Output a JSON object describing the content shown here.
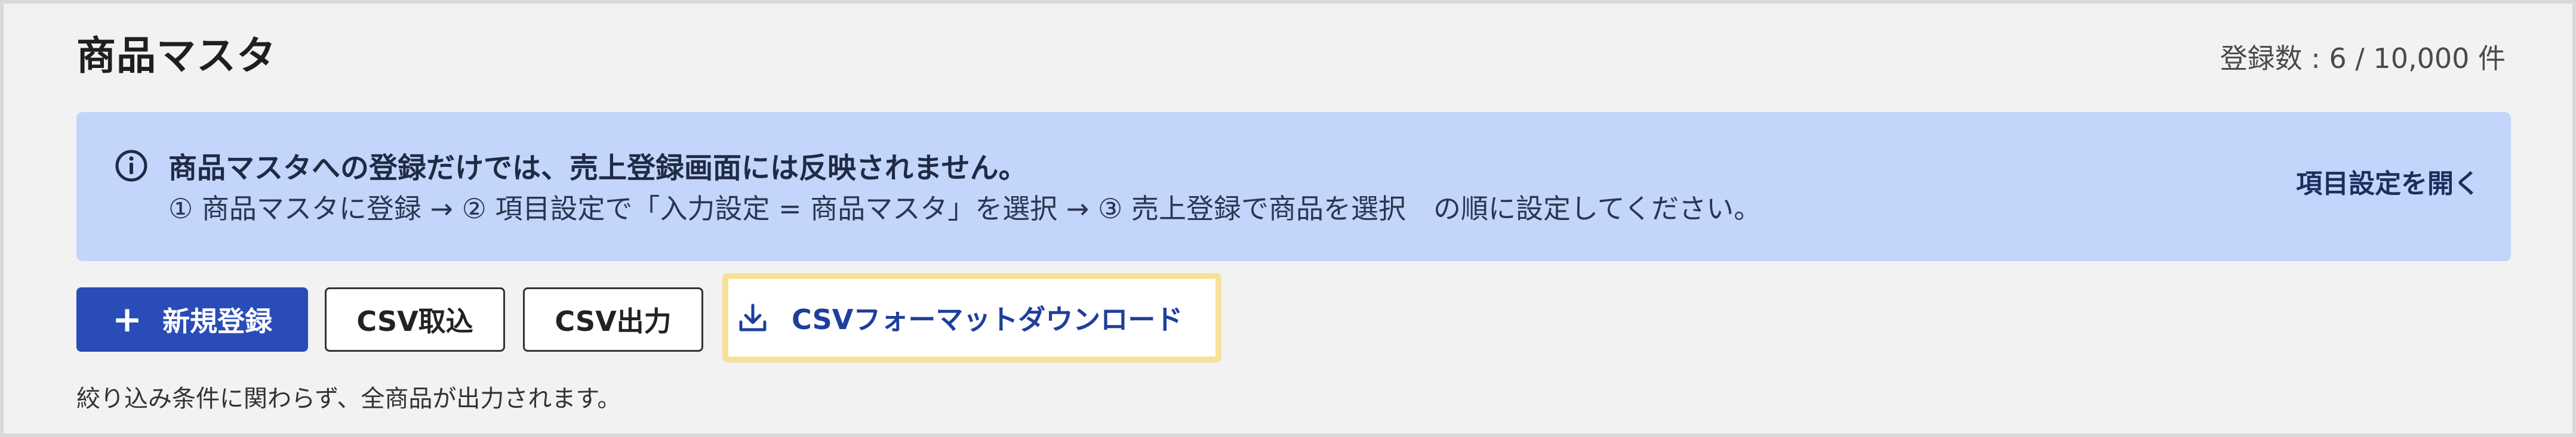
{
  "header": {
    "title": "商品マスタ",
    "registration_count": "登録数 : 6 / 10,000 件"
  },
  "info_banner": {
    "icon": "info-circle-icon",
    "message": "商品マスタへの登録だけでは、売上登録画面には反映されません。",
    "instructions": "① 商品マスタに登録 → ② 項目設定で「入力設定 = 商品マスタ」を選択 → ③ 売上登録で商品を選択　の順に設定してください。",
    "link_label": "項目設定を開く",
    "background_color": "#c3d5fb"
  },
  "toolbar": {
    "new_register_label": "新規登録",
    "new_register_icon": "plus-icon",
    "csv_import_label": "CSV取込",
    "csv_export_label": "CSV出力",
    "csv_format_download_label": "CSVフォーマットダウンロード",
    "csv_format_download_icon": "download-icon",
    "primary_color": "#2a4cb8",
    "highlight_color": "#f6e19a"
  },
  "note": "絞り込み条件に関わらず、全商品が出力されます。"
}
